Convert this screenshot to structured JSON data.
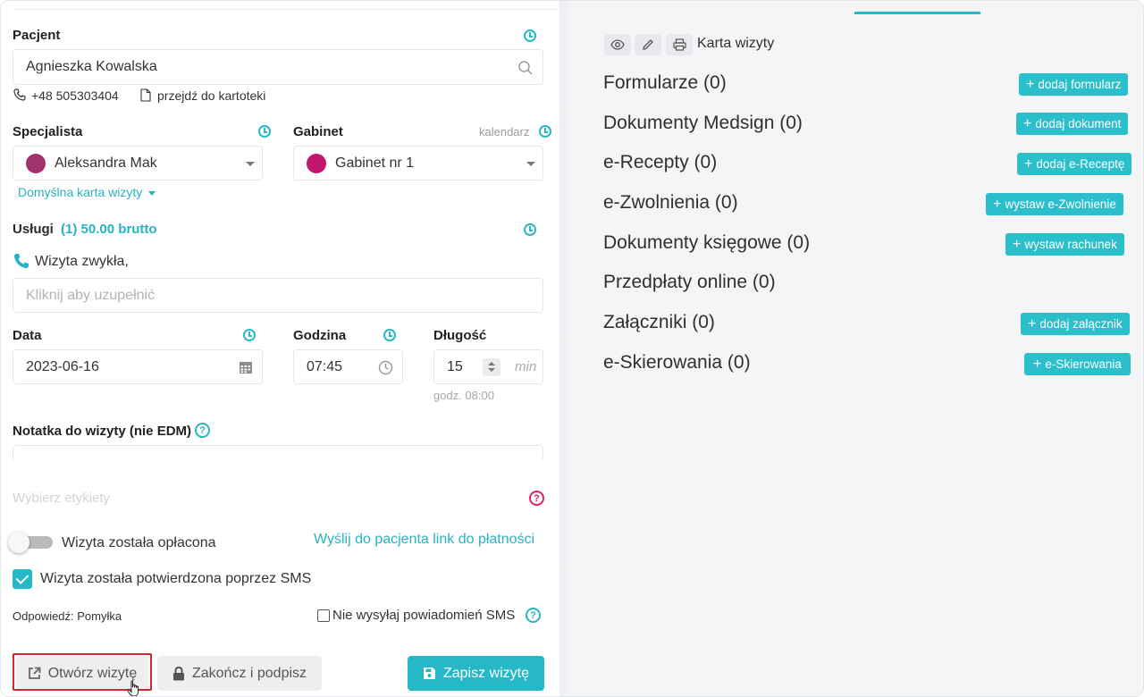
{
  "patient": {
    "label": "Pacjent",
    "name": "Agnieszka Kowalska",
    "phone": "+48 505303404",
    "chart_link": "przejdź do kartoteki"
  },
  "specialist": {
    "label": "Specjalista",
    "value": "Aleksandra Mak",
    "color": "#a0326e",
    "default_card": "Domyślna karta wizyty"
  },
  "office": {
    "label": "Gabinet",
    "calendar_link": "kalendarz",
    "value": "Gabinet nr 1",
    "color": "#c4166e"
  },
  "services": {
    "label": "Usługi",
    "summary": "(1) 50.00 brutto",
    "item": "Wizyta zwykła,",
    "placeholder": "Kliknij aby uzupełnić"
  },
  "date": {
    "label": "Data",
    "value": "2023-06-16"
  },
  "time": {
    "label": "Godzina",
    "value": "07:45"
  },
  "duration": {
    "label": "Długość",
    "value": "15",
    "unit": "min",
    "end_hint": "godz. 08:00"
  },
  "note": {
    "label": "Notatka do wizyty (nie EDM)"
  },
  "tags": {
    "placeholder": "Wybierz etykiety"
  },
  "payment": {
    "toggle_label": "Wizyta została opłacona",
    "toggle_on": false,
    "link": "Wyślij do pacjenta link do płatności"
  },
  "sms": {
    "confirmed_label": "Wizyta została potwierdzona poprzez SMS",
    "confirmed": true,
    "reply": "Odpowiedź: Pomyłka",
    "no_notify_label": "Nie wysyłaj powiadomień SMS",
    "no_notify": false
  },
  "actions": {
    "open": "Otwórz wizytę",
    "finish": "Zakończ i podpisz",
    "save": "Zapisz wizytę"
  },
  "right": {
    "card_title": "Karta wizyty",
    "sections": [
      {
        "title": "Formularze (0)",
        "button": "dodaj formularz"
      },
      {
        "title": "Dokumenty Medsign (0)",
        "button": "dodaj dokument"
      },
      {
        "title": "e-Recepty (0)",
        "button": "dodaj e-Receptę"
      },
      {
        "title": "e-Zwolnienia (0)",
        "button": "wystaw e-Zwolnienie"
      },
      {
        "title": "Dokumenty księgowe (0)",
        "button": "wystaw rachunek"
      },
      {
        "title": "Przedpłaty online (0)",
        "button": ""
      },
      {
        "title": "Załączniki (0)",
        "button": "dodaj załącznik"
      },
      {
        "title": "e-Skierowania (0)",
        "button": "e-Skierowania"
      }
    ]
  },
  "colors": {
    "accent": "#27b8c7",
    "highlight": "#d9252e",
    "tag_help": "#e0245e"
  }
}
